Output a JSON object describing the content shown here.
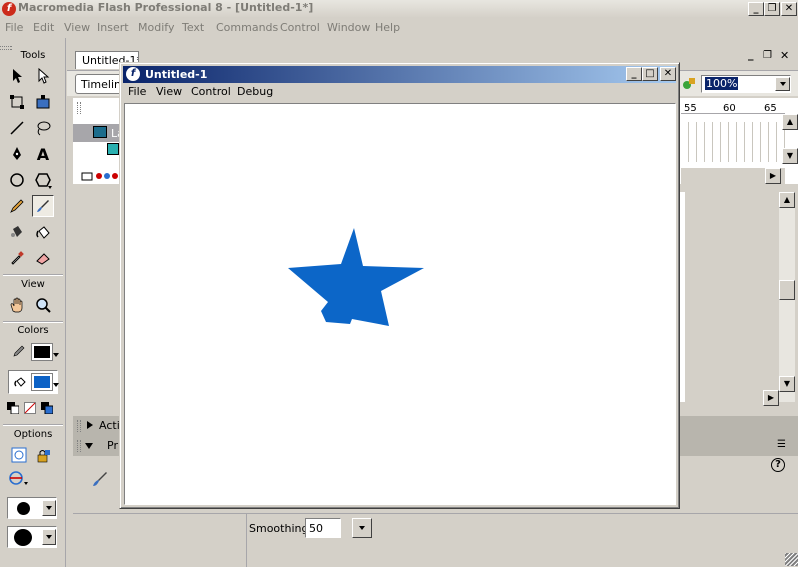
{
  "app": {
    "title": "Macromedia Flash Professional 8 - [Untitled-1*]",
    "icon_letter": "f"
  },
  "menu": [
    "File",
    "Edit",
    "View",
    "Insert",
    "Modify",
    "Text",
    "Commands",
    "Control",
    "Window",
    "Help"
  ],
  "tools": {
    "title": "Tools",
    "view_label": "View",
    "colors_label": "Colors",
    "options_label": "Options",
    "stroke_color": "#000000",
    "fill_color": "#0c62c6"
  },
  "document": {
    "tab_label": "Untitled-1*",
    "timeline_label": "Timelin",
    "layer_label": "La",
    "frame_numbers": [
      "55",
      "60",
      "65"
    ],
    "zoom": "100%",
    "actions_label": "Actio",
    "properties_label": "Pr"
  },
  "player": {
    "title": "Untitled-1",
    "menu": [
      "File",
      "View",
      "Control",
      "Debug"
    ],
    "shape_color": "#0c66c8"
  },
  "properties": {
    "smoothing_label": "Smoothing",
    "smoothing_value": "50"
  }
}
